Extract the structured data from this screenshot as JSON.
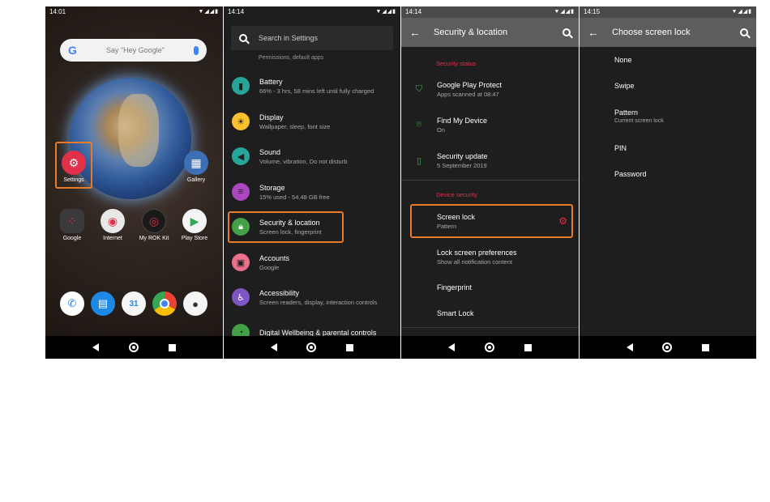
{
  "home": {
    "time": "14:01",
    "search_hint": "Say \"Hey Google\"",
    "google_letter": "G",
    "apps": [
      {
        "label": "Settings"
      },
      {
        "label": "Gallery"
      },
      {
        "label": "Google"
      },
      {
        "label": "Internet"
      },
      {
        "label": "My ROK Kit"
      },
      {
        "label": "Play Store"
      }
    ],
    "calendar_day": "31"
  },
  "settings": {
    "time": "14:14",
    "search_placeholder": "Search in Settings",
    "partial_row": "Permissions, default apps",
    "items": [
      {
        "title": "Battery",
        "sub": "66% - 3 hrs, 58 mins left until fully charged",
        "icon": "battery-icon",
        "color": "#26a69a"
      },
      {
        "title": "Display",
        "sub": "Wallpaper, sleep, font size",
        "icon": "brightness-icon",
        "color": "#fbc02d"
      },
      {
        "title": "Sound",
        "sub": "Volume, vibration, Do not disturb",
        "icon": "volume-icon",
        "color": "#26a69a"
      },
      {
        "title": "Storage",
        "sub": "15% used - 54.48 GB free",
        "icon": "storage-icon",
        "color": "#ab47bc"
      },
      {
        "title": "Security & location",
        "sub": "Screen lock, fingerprint",
        "icon": "lock-icon",
        "color": "#43a047"
      },
      {
        "title": "Accounts",
        "sub": "Google",
        "icon": "account-icon",
        "color": "#ec6f8c"
      },
      {
        "title": "Accessibility",
        "sub": "Screen readers, display, interaction controls",
        "icon": "accessibility-icon",
        "color": "#7e57c2"
      },
      {
        "title": "Digital Wellbeing & parental controls",
        "sub": "",
        "icon": "wellbeing-icon",
        "color": "#43a047"
      }
    ]
  },
  "security": {
    "time": "14:14",
    "title": "Security & location",
    "status_header": "Security status",
    "device_header": "Device security",
    "status_items": [
      {
        "title": "Google Play Protect",
        "sub": "Apps scanned at 08:47",
        "icon": "shield-icon"
      },
      {
        "title": "Find My Device",
        "sub": "On",
        "icon": "location-pin-icon"
      },
      {
        "title": "Security update",
        "sub": "5 September 2019",
        "icon": "phone-update-icon"
      }
    ],
    "device_items": [
      {
        "title": "Screen lock",
        "sub": "Pattern"
      },
      {
        "title": "Lock screen preferences",
        "sub": "Show all notification content"
      },
      {
        "title": "Fingerprint",
        "sub": ""
      },
      {
        "title": "Smart Lock",
        "sub": ""
      }
    ]
  },
  "screenlock": {
    "time": "14:15",
    "title": "Choose screen lock",
    "options": [
      {
        "title": "None",
        "sub": ""
      },
      {
        "title": "Swipe",
        "sub": ""
      },
      {
        "title": "Pattern",
        "sub": "Current screen lock"
      },
      {
        "title": "PIN",
        "sub": ""
      },
      {
        "title": "Password",
        "sub": ""
      }
    ]
  },
  "accent_color": "#e87b2a",
  "section_color": "#e0304a"
}
